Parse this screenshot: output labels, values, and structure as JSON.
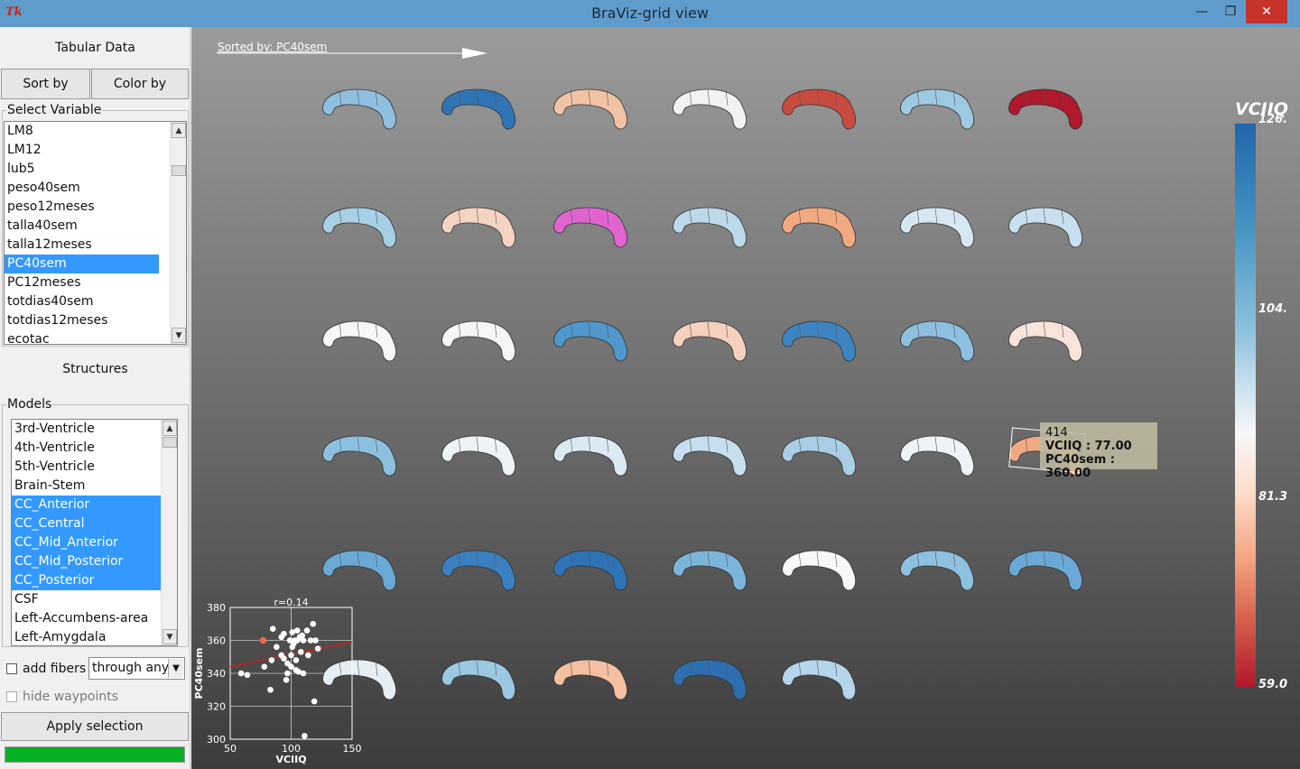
{
  "window": {
    "title": "BraViz-grid view",
    "app_icon": "Tk",
    "minimize_icon": "minimize-icon",
    "maximize_icon": "maximize-icon",
    "close_icon": "close-icon"
  },
  "left_panel": {
    "tabular_title": "Tabular Data",
    "sort_by_label": "Sort by",
    "color_by_label": "Color by",
    "select_variable_legend": "Select Variable",
    "variables": [
      "LM8",
      "LM12",
      "lub5",
      "peso40sem",
      "peso12meses",
      "talla40sem",
      "talla12meses",
      "PC40sem",
      "PC12meses",
      "totdias40sem",
      "totdias12meses",
      "ecotac"
    ],
    "selected_variable": "PC40sem",
    "structures_title": "Structures",
    "models_legend": "Models",
    "models": [
      "3rd-Ventricle",
      "4th-Ventricle",
      "5th-Ventricle",
      "Brain-Stem",
      "CC_Anterior",
      "CC_Central",
      "CC_Mid_Anterior",
      "CC_Mid_Posterior",
      "CC_Posterior",
      "CSF",
      "Left-Accumbens-area",
      "Left-Amygdala"
    ],
    "selected_models": [
      "CC_Anterior",
      "CC_Central",
      "CC_Mid_Anterior",
      "CC_Mid_Posterior",
      "CC_Posterior"
    ],
    "add_fibers_label": "add fibers",
    "add_fibers_checked": false,
    "fibers_mode": "through any",
    "hide_waypoints_label": "hide waypoints",
    "hide_waypoints_checked": false,
    "apply_label": "Apply selection",
    "progress": 1.0,
    "progress_color": "#06b025"
  },
  "viewer": {
    "sorted_by_label": "Sorted by: PC40sem",
    "colorbar": {
      "title": "VCIIQ",
      "labels": [
        "126.",
        "104.",
        "81.3",
        "59.0"
      ],
      "max": 126,
      "min": 59
    },
    "tooltip": {
      "subject": "414",
      "line1": "VCIIQ : 77.00",
      "line2": "PC40sem : 360.00"
    },
    "brain_colors": [
      [
        "#8fbfdf",
        "#2f74b5",
        "#f1c2a4",
        "#f2f2f2",
        "#c94a3e",
        "#9ecae1",
        "#b0182b"
      ],
      [
        "#a7cfe6",
        "#f4d3c2",
        "#e064d0",
        "#bcd9ea",
        "#f1a97f",
        "#d6e7f1",
        "#c7dfee"
      ],
      [
        "#f7f7f7",
        "#f5f5f5",
        "#4f97cc",
        "#f4d0bd",
        "#3d85c2",
        "#8dbfdf",
        "#f8e4da"
      ],
      [
        "#8dbfdf",
        "#eef3f6",
        "#dbe9f3",
        "#c6deee",
        "#a8cde5",
        "#eef3f6",
        "#efaa84"
      ],
      [
        "#6aa9d6",
        "#3a7fbf",
        "#2e73b5",
        "#7cb5dc",
        "#f8f8f8",
        "#8ec0e0",
        "#6aa9d6"
      ],
      [
        "#e5eef4",
        "#9bc9e3",
        "#f3c0a2",
        "#2e6fb0",
        "#b4d5ea"
      ]
    ]
  },
  "chart_data": {
    "type": "scatter",
    "title": "r=0.14",
    "xlabel": "VCIIQ",
    "ylabel": "PC40sem",
    "xlim": [
      50,
      150
    ],
    "ylim": [
      300,
      380
    ],
    "xticks": [
      "50",
      "100",
      "150"
    ],
    "yticks": [
      "300",
      "320",
      "340",
      "360",
      "380"
    ],
    "grid": true,
    "points": [
      [
        59,
        340
      ],
      [
        64,
        339
      ],
      [
        78,
        344
      ],
      [
        83,
        330
      ],
      [
        84,
        348
      ],
      [
        85,
        367
      ],
      [
        88,
        356
      ],
      [
        92,
        362
      ],
      [
        92,
        351
      ],
      [
        94,
        364
      ],
      [
        94,
        349
      ],
      [
        96,
        336
      ],
      [
        97,
        340
      ],
      [
        97,
        346
      ],
      [
        99,
        360
      ],
      [
        100,
        351
      ],
      [
        100,
        344
      ],
      [
        101,
        365
      ],
      [
        101,
        356
      ],
      [
        102,
        358
      ],
      [
        103,
        360
      ],
      [
        104,
        348
      ],
      [
        104,
        342
      ],
      [
        105,
        366
      ],
      [
        105,
        360
      ],
      [
        106,
        341
      ],
      [
        107,
        362
      ],
      [
        108,
        353
      ],
      [
        109,
        363
      ],
      [
        110,
        340
      ],
      [
        110,
        360
      ],
      [
        111,
        302
      ],
      [
        113,
        366
      ],
      [
        114,
        351
      ],
      [
        116,
        360
      ],
      [
        118,
        370
      ],
      [
        119,
        323
      ],
      [
        120,
        360
      ],
      [
        122,
        355
      ]
    ],
    "highlight": {
      "x": 77,
      "y": 360,
      "color": "#ee6a4a"
    },
    "regression": {
      "x": [
        50,
        150
      ],
      "y": [
        344,
        359
      ],
      "color": "#cc1f1f"
    }
  }
}
